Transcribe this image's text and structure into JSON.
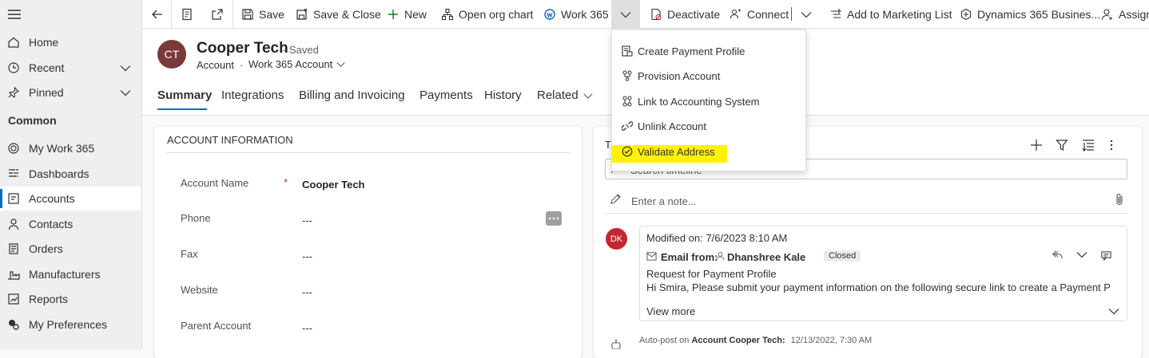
{
  "sidebar": {
    "items": [
      {
        "label": "Home",
        "icon": "home-icon"
      },
      {
        "label": "Recent",
        "icon": "clock-icon"
      },
      {
        "label": "Pinned",
        "icon": "pin-icon"
      }
    ],
    "group_label": "Common",
    "common_items": [
      {
        "label": "My Work 365",
        "icon": "work365-icon"
      },
      {
        "label": "Dashboards",
        "icon": "dashboard-icon"
      },
      {
        "label": "Accounts",
        "icon": "accounts-icon"
      },
      {
        "label": "Contacts",
        "icon": "person-icon"
      },
      {
        "label": "Orders",
        "icon": "orders-icon"
      },
      {
        "label": "Manufacturers",
        "icon": "manufacturers-icon"
      },
      {
        "label": "Reports",
        "icon": "reports-icon"
      },
      {
        "label": "My Preferences",
        "icon": "preferences-icon"
      }
    ],
    "active": "Accounts"
  },
  "toolbar": {
    "save": "Save",
    "save_close": "Save & Close",
    "new": "New",
    "open_org_chart": "Open org chart",
    "work365": "Work 365",
    "deactivate": "Deactivate",
    "connect": "Connect",
    "add_marketing": "Add to Marketing List",
    "dynamics": "Dynamics 365 Busines...",
    "assign": "Assign"
  },
  "record": {
    "initials": "CT",
    "name": "Cooper Tech",
    "status": "- Saved",
    "entity": "Account",
    "form": "Work 365 Account"
  },
  "tabs": [
    "Summary",
    "Integrations",
    "Billing and Invoicing",
    "Payments",
    "History",
    "Related"
  ],
  "account_info": {
    "section_title": "ACCOUNT INFORMATION",
    "fields": [
      {
        "label": "Account Name",
        "value": "Cooper Tech",
        "required": "*"
      },
      {
        "label": "Phone",
        "value": "---"
      },
      {
        "label": "Fax",
        "value": "---"
      },
      {
        "label": "Website",
        "value": "---"
      },
      {
        "label": "Parent Account",
        "value": "---"
      }
    ]
  },
  "timeline": {
    "title_fragment": "T",
    "search_placeholder": "Search timeline",
    "note_placeholder": "Enter a note...",
    "entry": {
      "initials": "DK",
      "modified": "Modified on: 7/6/2023 8:10 AM",
      "email_from": "Email from:",
      "sender": "Dhanshree Kale",
      "badge": "Closed",
      "subject": "Request for Payment Profile",
      "body": "Hi Smira, Please submit your payment information on the following secure link to create a Payment P...",
      "view_more": "View more"
    },
    "autopost": {
      "prefix": "Auto-post",
      "on": "on",
      "target": "Account Cooper Tech:",
      "date": "12/13/2022, 7:30 AM"
    }
  },
  "dropdown": {
    "items": [
      {
        "label": "Create Payment Profile",
        "icon": "payment-profile-icon"
      },
      {
        "label": "Provision Account",
        "icon": "provision-icon"
      },
      {
        "label": "Link to Accounting System",
        "icon": "link-accounting-icon"
      },
      {
        "label": "Unlink Account",
        "icon": "unlink-icon"
      },
      {
        "label": "Validate Address",
        "icon": "check-circle-icon"
      }
    ],
    "highlighted": "Validate Address"
  },
  "colors": {
    "accent": "#0f6cbd",
    "avatar_ct": "#7a3a3a",
    "avatar_dk": "#c4262e",
    "highlight": "#fff200",
    "required": "#c4262e"
  }
}
